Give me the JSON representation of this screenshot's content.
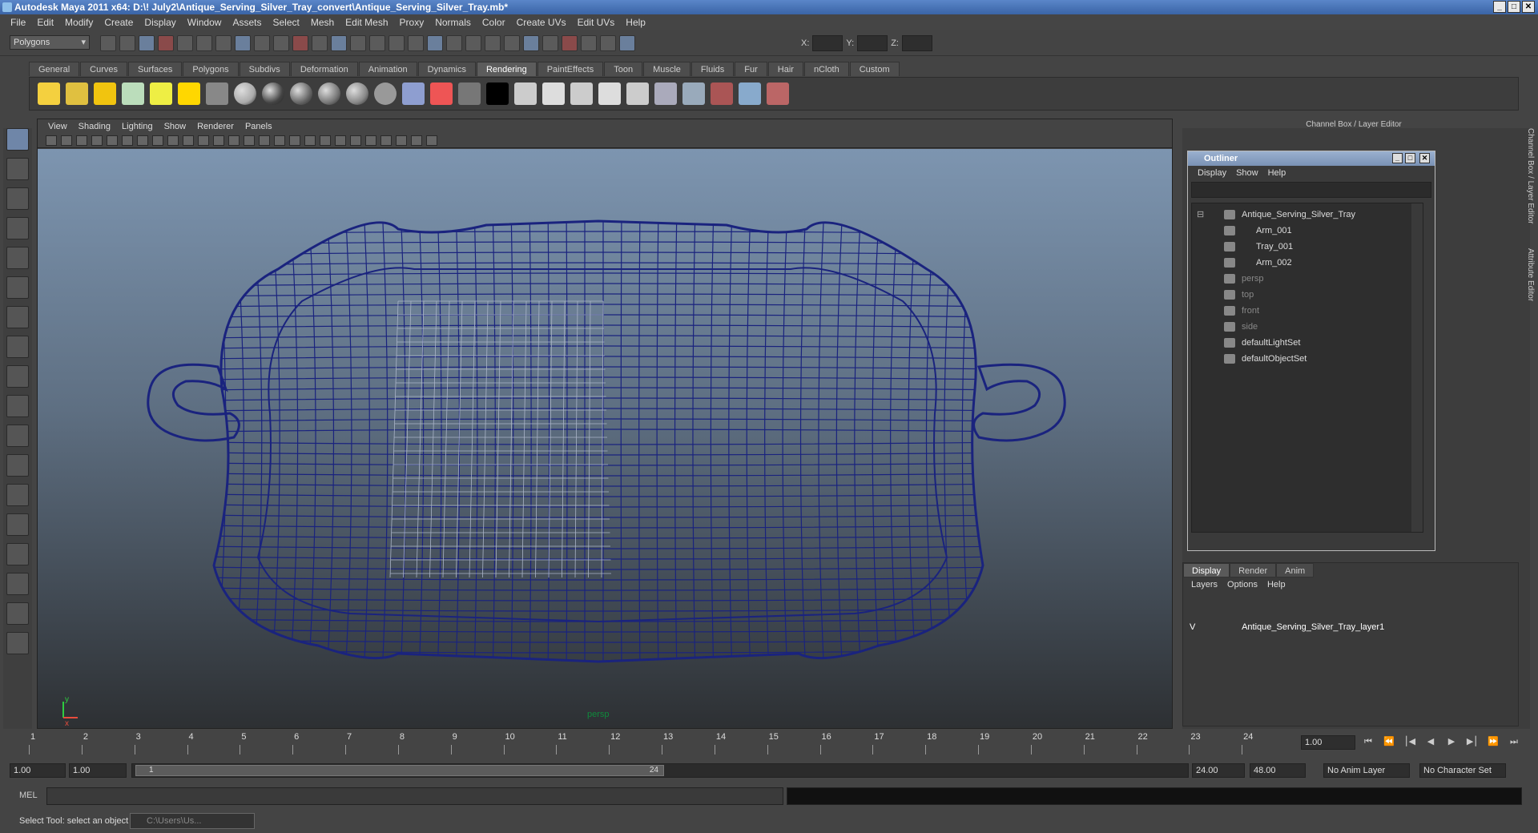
{
  "window": {
    "title": "Autodesk Maya 2011 x64: D:\\! July2\\Antique_Serving_Silver_Tray_convert\\Antique_Serving_Silver_Tray.mb*"
  },
  "menu": [
    "File",
    "Edit",
    "Modify",
    "Create",
    "Display",
    "Window",
    "Assets",
    "Select",
    "Mesh",
    "Edit Mesh",
    "Proxy",
    "Normals",
    "Color",
    "Create UVs",
    "Edit UVs",
    "Help"
  ],
  "status": {
    "mode": "Polygons",
    "x_label": "X:",
    "y_label": "Y:",
    "z_label": "Z:"
  },
  "shelf_tabs": [
    "General",
    "Curves",
    "Surfaces",
    "Polygons",
    "Subdivs",
    "Deformation",
    "Animation",
    "Dynamics",
    "Rendering",
    "PaintEffects",
    "Toon",
    "Muscle",
    "Fluids",
    "Fur",
    "Hair",
    "nCloth",
    "Custom"
  ],
  "shelf_active": "Rendering",
  "viewport": {
    "menu": [
      "View",
      "Shading",
      "Lighting",
      "Show",
      "Renderer",
      "Panels"
    ],
    "camera": "persp",
    "axis_y": "y",
    "axis_x": "x"
  },
  "channel_box_title": "Channel Box / Layer Editor",
  "side_tabs": [
    "Channel Box / Layer Editor",
    "Attribute Editor"
  ],
  "outliner": {
    "title": "Outliner",
    "menu": [
      "Display",
      "Show",
      "Help"
    ],
    "items": [
      {
        "label": "Antique_Serving_Silver_Tray",
        "depth": 0,
        "dim": false
      },
      {
        "label": "Arm_001",
        "depth": 1,
        "dim": false
      },
      {
        "label": "Tray_001",
        "depth": 1,
        "dim": false
      },
      {
        "label": "Arm_002",
        "depth": 1,
        "dim": false
      },
      {
        "label": "persp",
        "depth": 0,
        "dim": true
      },
      {
        "label": "top",
        "depth": 0,
        "dim": true
      },
      {
        "label": "front",
        "depth": 0,
        "dim": true
      },
      {
        "label": "side",
        "depth": 0,
        "dim": true
      },
      {
        "label": "defaultLightSet",
        "depth": 0,
        "dim": false
      },
      {
        "label": "defaultObjectSet",
        "depth": 0,
        "dim": false
      }
    ]
  },
  "layer_editor": {
    "tabs": [
      "Display",
      "Render",
      "Anim"
    ],
    "active_tab": "Display",
    "menu": [
      "Layers",
      "Options",
      "Help"
    ],
    "layers": [
      {
        "visible": "V",
        "name": "Antique_Serving_Silver_Tray_layer1"
      }
    ]
  },
  "timeline": {
    "start": 1,
    "end": 24,
    "ticks": [
      "1",
      "2",
      "3",
      "4",
      "5",
      "6",
      "7",
      "8",
      "9",
      "10",
      "11",
      "12",
      "13",
      "14",
      "15",
      "16",
      "17",
      "18",
      "19",
      "20",
      "21",
      "22",
      "23",
      "24"
    ],
    "current": "1.00"
  },
  "range": {
    "start_time": "1.00",
    "start_playback": "1.00",
    "range_start_label": "1",
    "range_end_label": "24",
    "end_playback": "24.00",
    "end_time": "48.00",
    "anim_layer": "No Anim Layer",
    "char_set": "No Character Set"
  },
  "command_line": {
    "label": "MEL"
  },
  "help_line": {
    "text": "Select Tool: select an object",
    "task": "C:\\Users\\Us..."
  },
  "colors": {
    "wireframe": "#1a237e",
    "accent": "#5c84c4"
  }
}
